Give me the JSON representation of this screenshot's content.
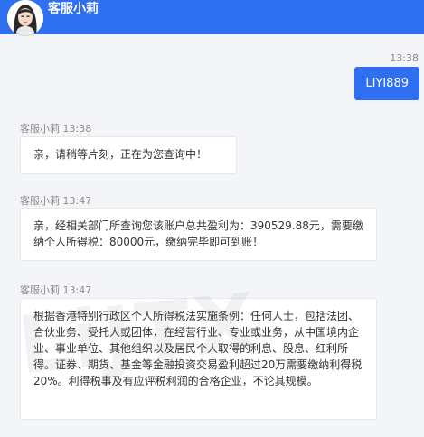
{
  "header": {
    "title": "客服小莉"
  },
  "outgoing": {
    "time": "13:38",
    "text": "LIYI889"
  },
  "messages": [
    {
      "sender": "客服小莉",
      "time": "13:38",
      "text": "亲，请稍等片刻，正在为您查询中！"
    },
    {
      "sender": "客服小莉",
      "time": "13:47",
      "text": "亲，经相关部门所查询您该账户总共盈利为：390529.88元，需要缴纳个人所得税：80000元，缴纳完毕即可到账！"
    },
    {
      "sender": "客服小莉",
      "time": "13:47",
      "text": "根据香港特别行政区个人所得税法实施条例：任何人士，包括法团、合伙业务、受托人或团体，在经营行业、专业或业务，从中国境内企业、事业单位、其他组织以及居民个人取得的利息、股息、红利所得。证券、期货、基金等金融投资交易盈利超过20万需要缴纳利得税20%。利得税事及有应评税利润的合格企业，不论其规模。"
    }
  ],
  "watermark": "LiJTX",
  "colors": {
    "header": "#2f6ff2",
    "background": "#f3f5f9",
    "bubble_out": "#2f6ff2"
  }
}
